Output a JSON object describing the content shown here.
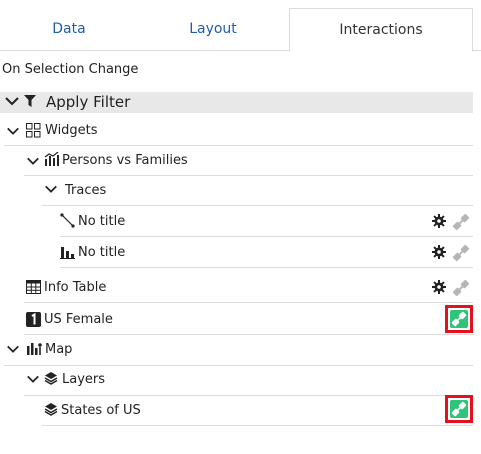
{
  "tabs": [
    {
      "label": "Data"
    },
    {
      "label": "Layout"
    },
    {
      "label": "Interactions"
    }
  ],
  "section_label": "On Selection Change",
  "filter": {
    "label": "Apply Filter"
  },
  "tree": {
    "widgets": "Widgets",
    "persons_vs_families": "Persons vs Families",
    "traces": "Traces",
    "trace_line": "No title",
    "trace_bar": "No title",
    "info_table": "Info Table",
    "us_female": "US Female",
    "map": "Map",
    "layers": "Layers",
    "states_of_us": "States of US"
  },
  "icons": {
    "chevron": "chevron-down-icon",
    "funnel": "funnel-icon",
    "widgets": "widgets-grid-icon",
    "chart": "chart-combo-icon",
    "line": "line-trace-icon",
    "bar": "bar-trace-icon",
    "table": "table-icon",
    "number": "number-card-icon",
    "map": "map-chart-icon",
    "layers": "layers-icon",
    "gear": "gear-icon",
    "plug": "plug-icon"
  },
  "colors": {
    "tab_link": "#1f5fa8",
    "active_plug_bg": "#2fc47a",
    "highlight_border": "#e3101e",
    "inactive_plug": "#b5b5b5",
    "filter_header_bg": "#e8e8e8"
  }
}
